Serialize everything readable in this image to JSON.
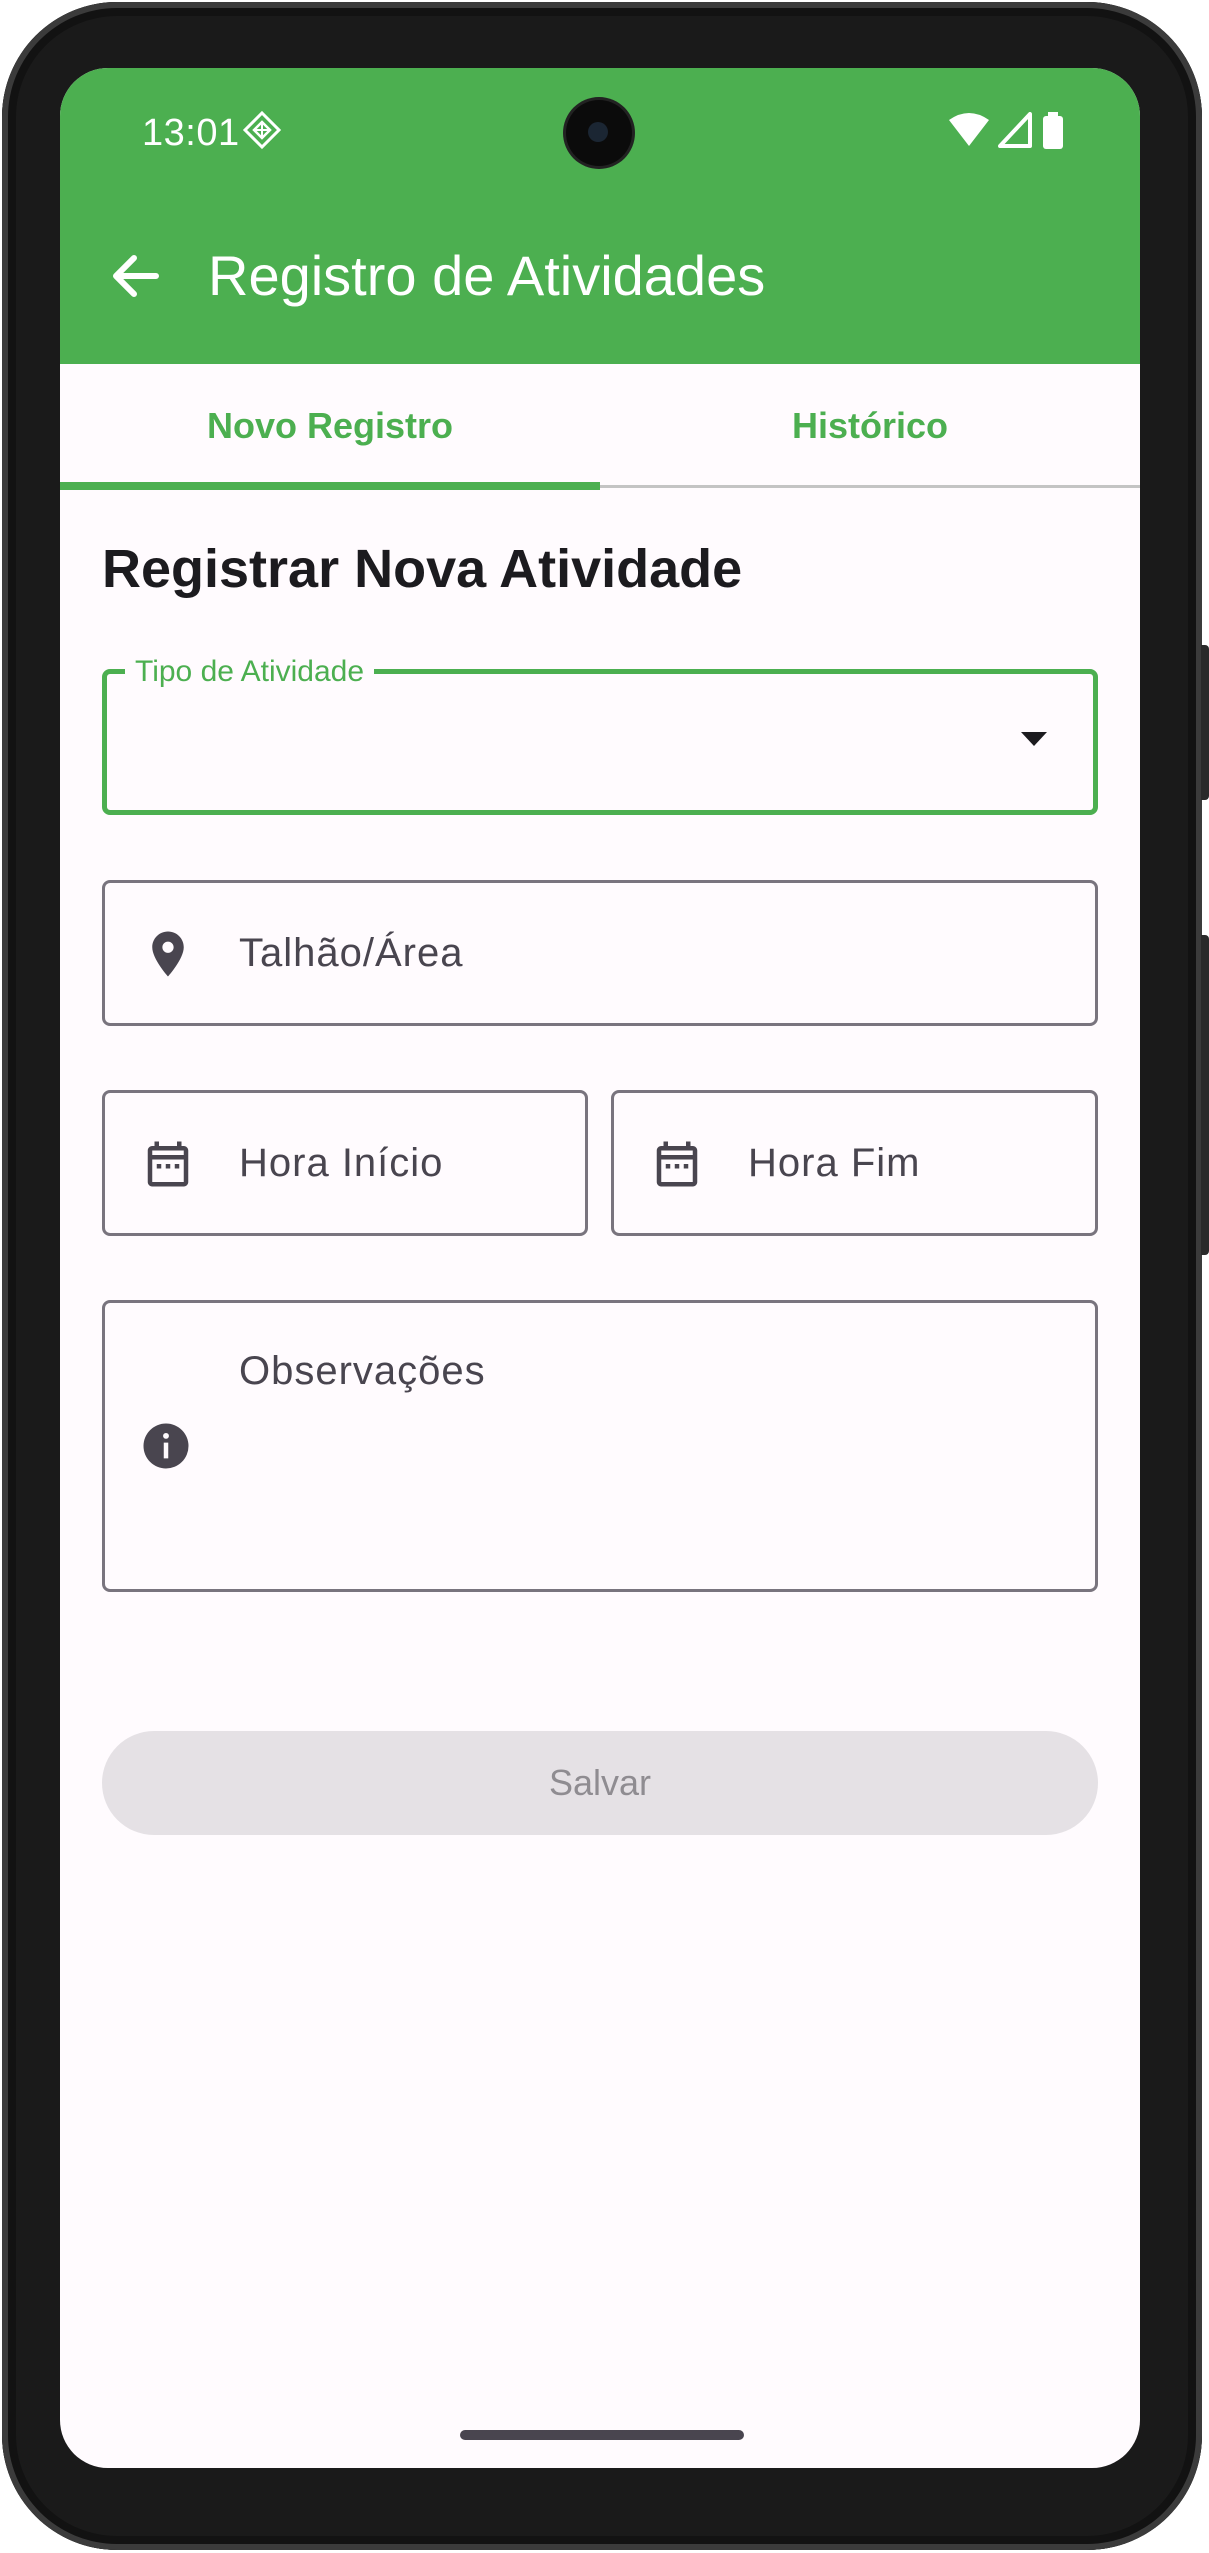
{
  "status_bar": {
    "time": "13:01",
    "icons": [
      "diamond-badge-icon",
      "wifi-icon",
      "signal-icon",
      "battery-icon"
    ]
  },
  "app_bar": {
    "title": "Registro de Atividades",
    "back_icon": "arrow-back-icon"
  },
  "tabs": [
    {
      "label": "Novo Registro",
      "selected": true
    },
    {
      "label": "Histórico",
      "selected": false
    }
  ],
  "form": {
    "title": "Registrar Nova Atividade",
    "activity_type": {
      "label": "Tipo de Atividade",
      "value": ""
    },
    "plot_area": {
      "placeholder": "Talhão/Área",
      "icon": "location-pin-icon"
    },
    "start_time": {
      "placeholder": "Hora Início",
      "icon": "calendar-icon"
    },
    "end_time": {
      "placeholder": "Hora Fim",
      "icon": "calendar-icon"
    },
    "notes": {
      "placeholder": "Observações",
      "icon": "info-icon"
    },
    "save_label": "Salvar"
  },
  "colors": {
    "primary": "#4caf50",
    "surface": "#fffbfe",
    "outline": "#79747e",
    "on_surface_variant": "#49454f",
    "disabled_button": "#e5e1e5"
  }
}
